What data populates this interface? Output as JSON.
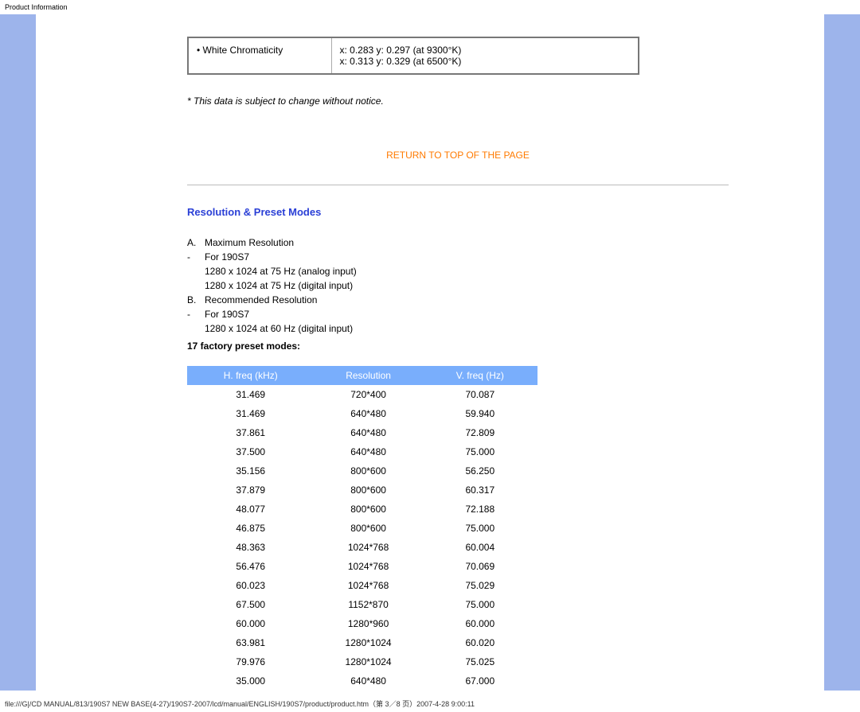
{
  "header": "Product Information",
  "chroma": {
    "label": "•  White Chromaticity",
    "v1": "x: 0.283 y: 0.297 (at 9300°K)",
    "v2": "x: 0.313 y: 0.329 (at 6500°K)"
  },
  "notice": "* This data is subject to change without notice.",
  "return_link": "RETURN TO TOP OF THE PAGE",
  "section_title": "Resolution & Preset Modes",
  "spec": {
    "a_mk": "A.",
    "a": "Maximum Resolution",
    "a_dash": "-",
    "a_for": "For 190S7",
    "a_l1": "1280 x 1024 at 75 Hz (analog input)",
    "a_l2": "1280 x 1024 at 75 Hz (digital input)",
    "b_mk": "B.",
    "b": "Recommended Resolution",
    "b_dash": "-",
    "b_for": "For 190S7",
    "b_l1": "1280 x 1024 at 60 Hz (digital input)"
  },
  "preset_heading": "17 factory preset modes:",
  "modes_headers": {
    "h": "H. freq (kHz)",
    "r": "Resolution",
    "v": "V. freq (Hz)"
  },
  "modes": [
    {
      "h": "31.469",
      "r": "720*400",
      "v": "70.087"
    },
    {
      "h": "31.469",
      "r": "640*480",
      "v": "59.940"
    },
    {
      "h": "37.861",
      "r": "640*480",
      "v": "72.809"
    },
    {
      "h": "37.500",
      "r": "640*480",
      "v": "75.000"
    },
    {
      "h": "35.156",
      "r": "800*600",
      "v": "56.250"
    },
    {
      "h": "37.879",
      "r": "800*600",
      "v": "60.317"
    },
    {
      "h": "48.077",
      "r": "800*600",
      "v": "72.188"
    },
    {
      "h": "46.875",
      "r": "800*600",
      "v": "75.000"
    },
    {
      "h": "48.363",
      "r": "1024*768",
      "v": "60.004"
    },
    {
      "h": "56.476",
      "r": "1024*768",
      "v": "70.069"
    },
    {
      "h": "60.023",
      "r": "1024*768",
      "v": "75.029"
    },
    {
      "h": "67.500",
      "r": "1152*870",
      "v": "75.000"
    },
    {
      "h": "60.000",
      "r": "1280*960",
      "v": "60.000"
    },
    {
      "h": "63.981",
      "r": "1280*1024",
      "v": "60.020"
    },
    {
      "h": "79.976",
      "r": "1280*1024",
      "v": "75.025"
    },
    {
      "h": "35.000",
      "r": "640*480",
      "v": "67.000"
    }
  ],
  "chart_data": {
    "type": "table",
    "title": "17 factory preset modes",
    "columns": [
      "H. freq (kHz)",
      "Resolution",
      "V. freq (Hz)"
    ],
    "rows": [
      [
        31.469,
        "720*400",
        70.087
      ],
      [
        31.469,
        "640*480",
        59.94
      ],
      [
        37.861,
        "640*480",
        72.809
      ],
      [
        37.5,
        "640*480",
        75.0
      ],
      [
        35.156,
        "800*600",
        56.25
      ],
      [
        37.879,
        "800*600",
        60.317
      ],
      [
        48.077,
        "800*600",
        72.188
      ],
      [
        46.875,
        "800*600",
        75.0
      ],
      [
        48.363,
        "1024*768",
        60.004
      ],
      [
        56.476,
        "1024*768",
        70.069
      ],
      [
        60.023,
        "1024*768",
        75.029
      ],
      [
        67.5,
        "1152*870",
        75.0
      ],
      [
        60.0,
        "1280*960",
        60.0
      ],
      [
        63.981,
        "1280*1024",
        60.02
      ],
      [
        79.976,
        "1280*1024",
        75.025
      ],
      [
        35.0,
        "640*480",
        67.0
      ]
    ]
  },
  "footer": "file:///G|/CD MANUAL/813/190S7 NEW BASE(4-27)/190S7-2007/lcd/manual/ENGLISH/190S7/product/product.htm（第 3／8 页）2007-4-28 9:00:11"
}
